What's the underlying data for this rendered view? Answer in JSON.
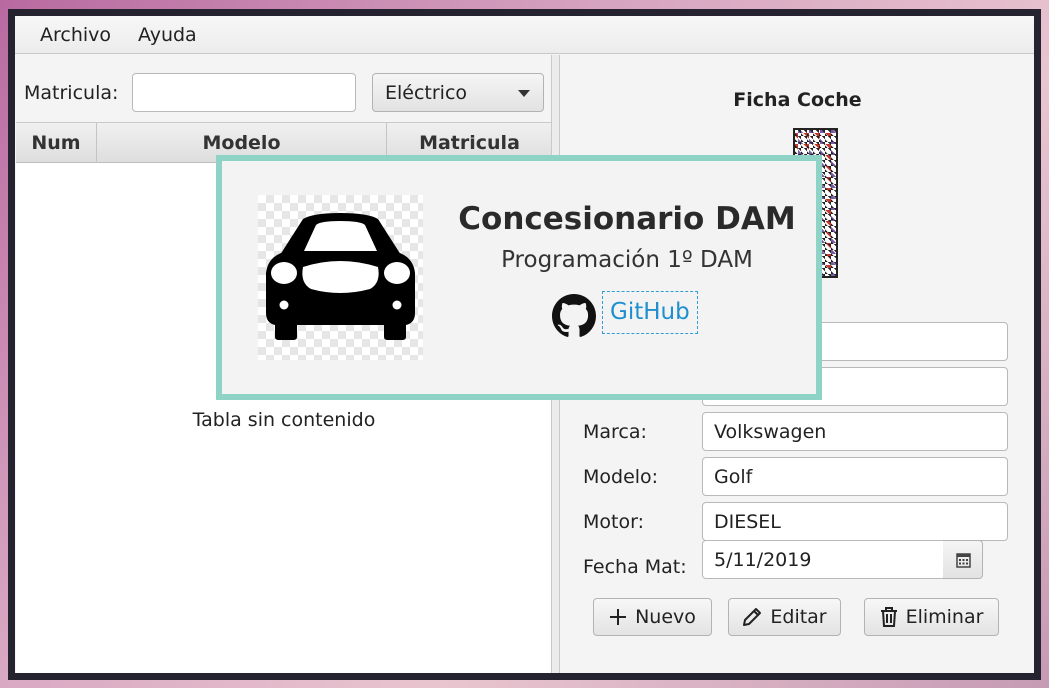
{
  "menu": {
    "file": "Archivo",
    "help": "Ayuda"
  },
  "filter": {
    "plate_label": "Matricula:",
    "plate_value": "",
    "type_selected": "Eléctrico"
  },
  "table": {
    "columns": [
      "Num",
      "Modelo",
      "Matricula"
    ],
    "empty_text": "Tabla sin contenido"
  },
  "detail": {
    "title": "Ficha Coche",
    "fields": [
      {
        "label": "Marca:",
        "value": "Volkswagen"
      },
      {
        "label": "Modelo:",
        "value": "Golf"
      },
      {
        "label": "Motor:",
        "value": "DIESEL"
      },
      {
        "label": "Fecha Mat:",
        "value": "5/11/2019"
      }
    ],
    "hidden_field_values": [
      "",
      ""
    ],
    "buttons": {
      "new": "Nuevo",
      "edit": "Editar",
      "delete": "Eliminar"
    }
  },
  "splash": {
    "title": "Concesionario DAM",
    "subtitle": "Programación 1º DAM",
    "link": "GitHub"
  },
  "icons": {
    "combo_arrow": "chevron-down-icon",
    "calendar": "calendar-icon",
    "new": "plus-icon",
    "edit": "pencil-icon",
    "delete": "trash-icon",
    "github": "github-icon",
    "car": "car-icon"
  },
  "colors": {
    "splash_border": "#8fd3c6",
    "link": "#1e8fcf",
    "window_frame": "#24232f"
  }
}
